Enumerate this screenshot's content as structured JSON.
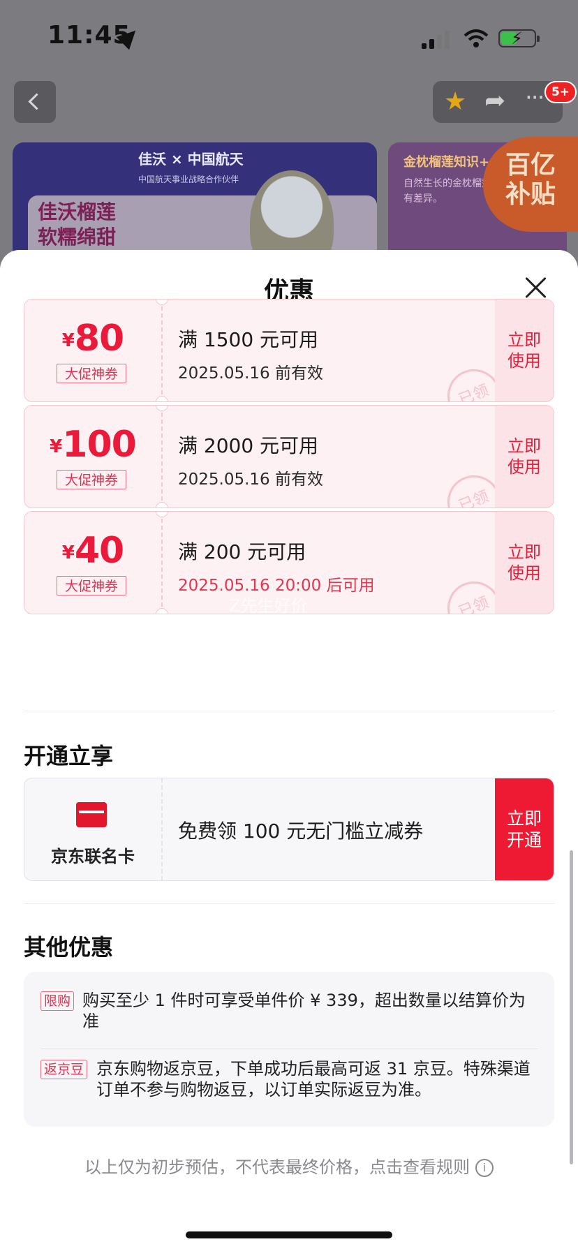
{
  "status_bar": {
    "time": "11:45"
  },
  "header": {
    "cart_badge": "5+"
  },
  "banners": {
    "left_brand": "佳沃 × 中国航天",
    "left_brand_sub": "中国航天事业战略合作伙伴",
    "left_slogan_line1": "佳沃榴莲",
    "left_slogan_line2": "软糯绵甜",
    "right_title": "金枕榴莲知识+",
    "right_body": "自然生长的金枕榴莲，果肉大小有差异。",
    "subsidy_line1": "百亿",
    "subsidy_line2": "补贴"
  },
  "sheet": {
    "title": "优惠"
  },
  "coupons": [
    {
      "currency": "¥",
      "amount": "80",
      "tag": "大促神券",
      "condition": "满 1500 元可用",
      "validity": "2025.05.16 前有效",
      "use_label": "立即使用",
      "stamp": "已领"
    },
    {
      "currency": "¥",
      "amount": "100",
      "tag": "大促神券",
      "condition": "满 2000 元可用",
      "validity": "2025.05.16 前有效",
      "use_label": "立即使用",
      "stamp": "已领"
    },
    {
      "currency": "¥",
      "amount": "40",
      "tag": "大促神券",
      "condition": "满 200 元可用",
      "validity": "2025.05.16 20:00 后可用",
      "use_label": "立即使用",
      "stamp": "已领"
    }
  ],
  "watermark": "Z先生好价",
  "open_section": {
    "title": "开通立享",
    "card_name": "京东联名卡",
    "offer": "免费领 100 元无门槛立减券",
    "open_label": "立即开通"
  },
  "other_section": {
    "title": "其他优惠",
    "items": [
      {
        "badge": "限购",
        "text": "购买至少 1 件时可享受单件价 ¥ 339，超出数量以结算价为准"
      },
      {
        "badge": "返京豆",
        "text": "京东购物返京豆，下单成功后最高可返 31 京豆。特殊渠道订单不参与购物返豆，以订单实际返豆为准。"
      }
    ]
  },
  "footnote": "以上仅为初步预估，不代表最终价格，点击查看规则",
  "colors": {
    "accent_red": "#ea1a3a",
    "coupon_bg": "#fdf1f3",
    "open_button": "#ee1a34"
  }
}
